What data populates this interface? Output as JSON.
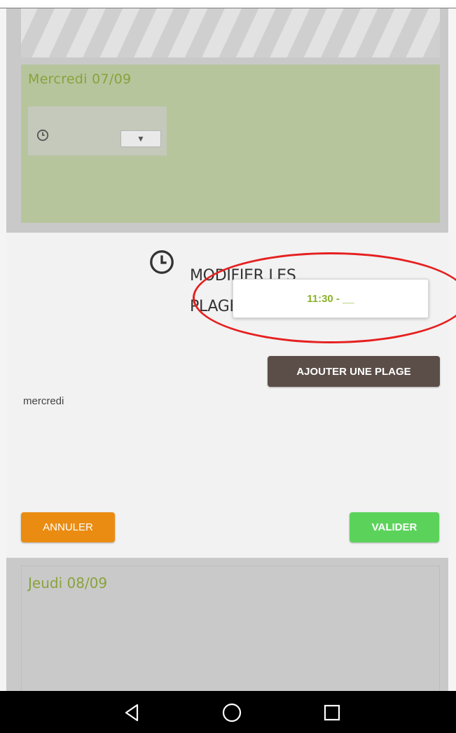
{
  "days": {
    "wednesday": {
      "title": "Mercredi 07/09",
      "select_arrow": "▼"
    },
    "thursday": {
      "title": "Jeudi 08/09"
    }
  },
  "modal": {
    "title": "MODIFIER LES PLAGES HORAIRES",
    "time_popup": "11:30 - __",
    "add_button": "AJOUTER UNE PLAGE",
    "day_label": "mercredi",
    "cancel_button": "ANNULER",
    "ok_button": "VALIDER"
  },
  "nav": {
    "back_icon": "back-triangle-icon",
    "home_icon": "home-circle-icon",
    "recents_icon": "recents-square-icon"
  },
  "colors": {
    "day_title": "#89a23b",
    "cancel": "#ea8c12",
    "ok": "#5bd35b",
    "add": "#5b4e48",
    "annotation": "#e62020"
  }
}
